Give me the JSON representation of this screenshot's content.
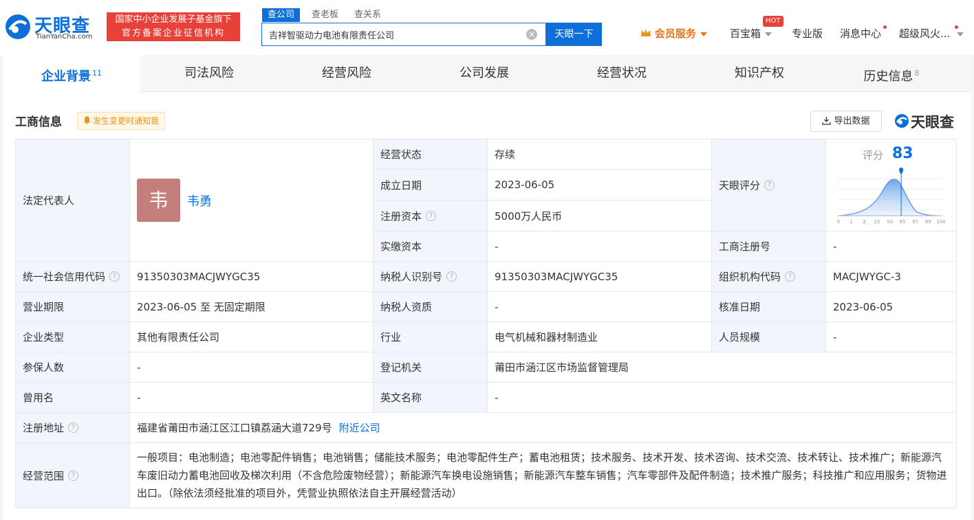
{
  "header": {
    "logo_text": "天眼查",
    "logo_sub": "TianYanCha.com",
    "badge_line1": "国家中小企业发展子基金旗下",
    "badge_line2": "官方备案企业征信机构",
    "search_tabs": [
      "查公司",
      "查老板",
      "查关系"
    ],
    "search_value": "吉祥智驱动力电池有限责任公司",
    "search_button": "天眼一下",
    "nav": {
      "vip": "会员服务",
      "toolbox": "百宝箱",
      "hot": "HOT",
      "pro": "专业版",
      "messages": "消息中心",
      "user": "超级风火..."
    }
  },
  "tabs": [
    {
      "label": "企业背景",
      "count": "11"
    },
    {
      "label": "司法风险",
      "count": ""
    },
    {
      "label": "经营风险",
      "count": ""
    },
    {
      "label": "公司发展",
      "count": ""
    },
    {
      "label": "经营状况",
      "count": ""
    },
    {
      "label": "知识产权",
      "count": ""
    },
    {
      "label": "历史信息",
      "count": "8"
    }
  ],
  "section": {
    "title": "工商信息",
    "notify": "发生变更时通知我",
    "export": "导出数据",
    "brand": "天眼查"
  },
  "info": {
    "legal_rep_label": "法定代表人",
    "legal_rep_initial": "韦",
    "legal_rep_name": "韦勇",
    "status_label": "经营状态",
    "status_value": "存续",
    "found_label": "成立日期",
    "found_value": "2023-06-05",
    "reg_cap_label": "注册资本",
    "reg_cap_value": "5000万人民币",
    "paid_cap_label": "实缴资本",
    "paid_cap_value": "-",
    "score_label_cell": "天眼评分",
    "score_label": "评分",
    "score_value": "83",
    "reg_no_label": "工商注册号",
    "reg_no_value": "-",
    "credit_code_label": "统一社会信用代码",
    "credit_code_value": "91350303MACJWYGC35",
    "taxpayer_id_label": "纳税人识别号",
    "taxpayer_id_value": "91350303MACJWYGC35",
    "org_code_label": "组织机构代码",
    "org_code_value": "MACJWYGC-3",
    "term_label": "营业期限",
    "term_value": "2023-06-05 至 无固定期限",
    "tax_qual_label": "纳税人资质",
    "tax_qual_value": "-",
    "approve_label": "核准日期",
    "approve_value": "2023-06-05",
    "type_label": "企业类型",
    "type_value": "其他有限责任公司",
    "industry_label": "行业",
    "industry_value": "电气机械和器材制造业",
    "staff_label": "人员规模",
    "staff_value": "-",
    "insured_label": "参保人数",
    "insured_value": "-",
    "authority_label": "登记机关",
    "authority_value": "莆田市涵江区市场监督管理局",
    "former_label": "曾用名",
    "former_value": "-",
    "english_label": "英文名称",
    "english_value": "-",
    "address_label": "注册地址",
    "address_value": "福建省莆田市涵江区江口镇荔涵大道729号",
    "nearby": "附近公司",
    "scope_label": "经营范围",
    "scope_value": "一般项目：电池制造；电池零配件销售；电池销售；储能技术服务；电池零配件生产；蓄电池租赁；技术服务、技术开发、技术咨询、技术交流、技术转让、技术推广；新能源汽车废旧动力蓄电池回收及梯次利用（不含危险废物经营）；新能源汽车换电设施销售；新能源汽车整车销售；汽车零部件及配件制造；技术推广服务；科技推广和应用服务；货物进出口。（除依法须经批准的项目外，凭营业执照依法自主开展经营活动）"
  },
  "score_chart": {
    "ticks": [
      "0",
      "1",
      "3",
      "15",
      "50",
      "85",
      "97",
      "89",
      "100"
    ],
    "marker_value": 83,
    "accent": "#0d6fd7"
  }
}
